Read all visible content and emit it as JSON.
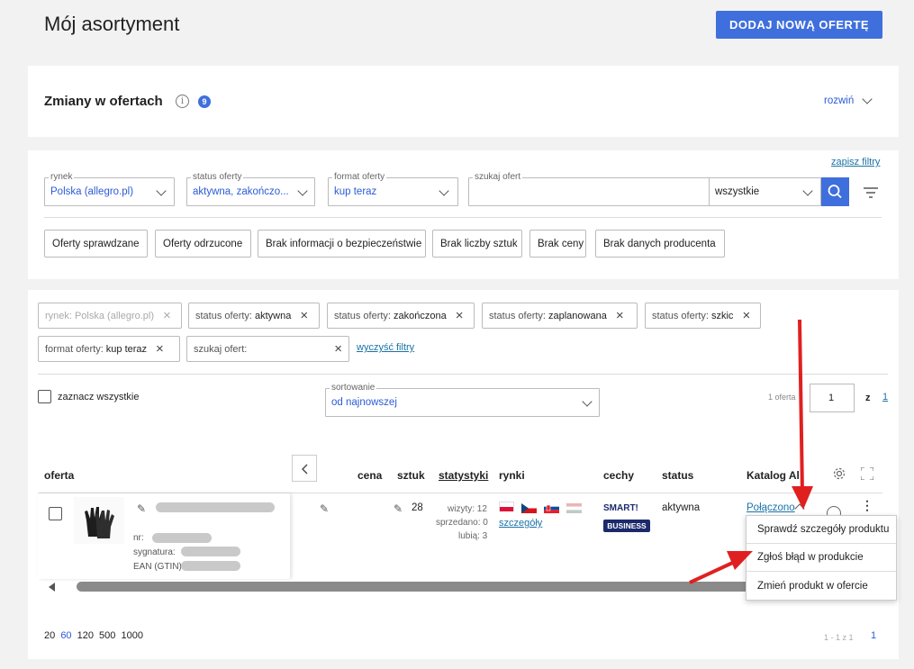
{
  "header": {
    "title": "Mój asortyment",
    "add_button": "DODAJ NOWĄ OFERTĘ"
  },
  "changes": {
    "title": "Zmiany w ofertach",
    "badge": "9",
    "expand": "rozwiń"
  },
  "filters": {
    "save_link": "zapisz filtry",
    "market": {
      "label": "rynek",
      "value": "Polska (allegro.pl)"
    },
    "status": {
      "label": "status oferty",
      "value": "aktywna, zakończo..."
    },
    "format": {
      "label": "format oferty",
      "value": "kup teraz"
    },
    "search": {
      "label": "szukaj ofert",
      "value": "",
      "scope": "wszystkie"
    },
    "quick": [
      "Oferty sprawdzane",
      "Oferty odrzucone",
      "Brak informacji o bezpieczeństwie",
      "Brak liczby sztuk",
      "Brak ceny",
      "Brak danych producenta"
    ]
  },
  "active_filters": [
    {
      "key": "rynek:",
      "value": "Polska (allegro.pl)",
      "disabled": true
    },
    {
      "key": "status oferty:",
      "value": "aktywna"
    },
    {
      "key": "status oferty:",
      "value": "zakończona"
    },
    {
      "key": "status oferty:",
      "value": "zaplanowana"
    },
    {
      "key": "status oferty:",
      "value": "szkic"
    },
    {
      "key": "format oferty:",
      "value": "kup teraz"
    },
    {
      "key": "szukaj ofert:",
      "value": ""
    }
  ],
  "clear_filters": "wyczyść filtry",
  "list": {
    "select_all": "zaznacz wszystkie",
    "sort_label": "sortowanie",
    "sort_value": "od najnowszej",
    "count_text": "1 oferta",
    "page_value": "1",
    "page_of": "z",
    "page_total": "1"
  },
  "table": {
    "headers": {
      "offer": "oferta",
      "price": "cena",
      "qty": "sztuk",
      "stats": "statystyki",
      "markets": "rynki",
      "features": "cechy",
      "status": "status",
      "catalog": "Katalog Al"
    },
    "row": {
      "nr_label": "nr:",
      "signature_label": "sygnatura:",
      "ean_label": "EAN (GTIN)",
      "qty": "28",
      "visits": "wizyty: 12",
      "sold": "sprzedano: 0",
      "likes": "lubią: 3",
      "details_link": "szczegóły",
      "smart": "SMART!",
      "business": "BUSINESS",
      "status": "aktywna",
      "catalog": "Połączono"
    }
  },
  "context_menu": [
    "Sprawdź szczegóły produktu",
    "Zgłoś błąd w produkcie",
    "Zmień produkt w ofercie"
  ],
  "footer": {
    "page_sizes": [
      "20",
      "60",
      "120",
      "500",
      "1000"
    ],
    "active_size": "60",
    "range": "1 - 1 z 1",
    "page": "1"
  },
  "colors": {
    "primary": "#3f6fdc",
    "link": "#1a73a8",
    "arrow": "#e02020"
  }
}
